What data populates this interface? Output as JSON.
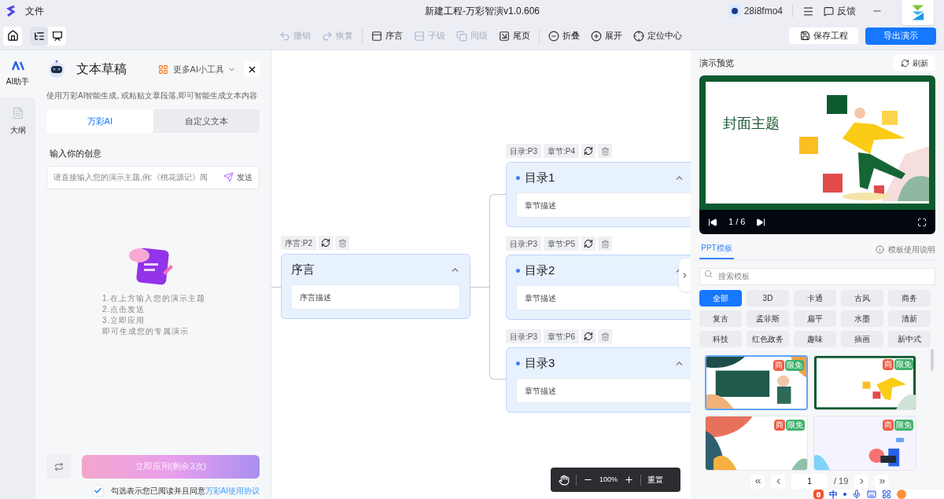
{
  "title_bar": {
    "menu": "文件",
    "title": "新建工程-万彩智演v1.0.606",
    "user": "28i8fmo4",
    "feedback": "反馈"
  },
  "toolbar": {
    "items": [
      {
        "kind": "undo",
        "label": "撤销",
        "disabled": true
      },
      {
        "kind": "redo",
        "label": "恢复",
        "disabled": true
      },
      {
        "kind": "preface",
        "label": "序言",
        "disabled": false
      },
      {
        "kind": "child",
        "label": "子级",
        "disabled": true
      },
      {
        "kind": "sibling",
        "label": "同级",
        "disabled": true
      },
      {
        "kind": "end",
        "label": "尾页",
        "disabled": false
      },
      {
        "kind": "collapse",
        "label": "折叠",
        "disabled": false
      },
      {
        "kind": "expand",
        "label": "展开",
        "disabled": false
      },
      {
        "kind": "locate",
        "label": "定位中心",
        "disabled": false
      }
    ],
    "save": "保存工程",
    "export": "导出演示"
  },
  "side_rail": [
    {
      "kind": "ai",
      "label": "AI助手",
      "selected": true
    },
    {
      "kind": "outline",
      "label": "大纲",
      "selected": false
    }
  ],
  "ai_panel": {
    "title": "文本草稿",
    "tools": "更多AI小工具",
    "description": "使用万彩AI智能生成, 或粘贴文章段落,即可智能生成文本内容",
    "tabs": [
      {
        "label": "万彩AI",
        "selected": true
      },
      {
        "label": "自定义文本",
        "selected": false
      }
    ],
    "input_label": "输入你的创意",
    "placeholder": "请直接输入您的演示主题,例:《桃花源记》阅",
    "send": "发送",
    "steps": [
      "1.在上方输入您的演示主题",
      "2.点击发送",
      "3.立即应用",
      "即可生成您的专属演示"
    ],
    "apply": "立即应用(剩余3次)",
    "agree": {
      "checked": true,
      "text": "勾选表示您已阅读并且同意",
      "link": "万彩AI使用协议"
    }
  },
  "canvas": {
    "root": {
      "tags": [
        "序言:P2"
      ],
      "title": "序言",
      "description": "序言描述",
      "expanded": true,
      "children": [
        {
          "tags": [
            "目录:P3",
            "章节:P4"
          ],
          "title": "目录1",
          "description": "章节描述",
          "expanded": true
        },
        {
          "tags": [
            "目录:P3",
            "章节:P5"
          ],
          "title": "目录2",
          "description": "章节描述",
          "expanded": true
        },
        {
          "tags": [
            "目录:P3",
            "章节:P6"
          ],
          "title": "目录3",
          "description": "章节描述",
          "expanded": true
        }
      ]
    },
    "zoom": "100%",
    "reset": "重置"
  },
  "preview": {
    "title": "演示预览",
    "refresh": "刷新",
    "slide_title": "封面主题",
    "page": "1 / 6"
  },
  "templates": {
    "tabs": [
      {
        "label": "PPT模板",
        "selected": true
      }
    ],
    "help": "模板使用说明",
    "search_placeholder": "搜索模板",
    "categories": [
      {
        "label": "全部",
        "selected": true
      },
      {
        "label": "3D",
        "selected": false
      },
      {
        "label": "卡通",
        "selected": false
      },
      {
        "label": "古风",
        "selected": false
      },
      {
        "label": "商务",
        "selected": false
      },
      {
        "label": "复古",
        "selected": false
      },
      {
        "label": "孟菲斯",
        "selected": false
      },
      {
        "label": "扁平",
        "selected": false
      },
      {
        "label": "水墨",
        "selected": false
      },
      {
        "label": "清新",
        "selected": false
      },
      {
        "label": "科技",
        "selected": false
      },
      {
        "label": "红色政务",
        "selected": false
      },
      {
        "label": "趣味",
        "selected": false
      },
      {
        "label": "插画",
        "selected": false
      },
      {
        "label": "新中式",
        "selected": false
      }
    ],
    "items": [
      {
        "selected": true,
        "badges": [
          "商",
          "限免"
        ]
      },
      {
        "selected": false,
        "badges": [
          "商",
          "限免"
        ]
      },
      {
        "selected": false,
        "badges": [
          "商",
          "限免"
        ]
      },
      {
        "selected": false,
        "badges": [
          "商",
          "限免"
        ]
      }
    ],
    "page": "1",
    "total": "/ 19"
  },
  "ime_bar": {
    "label": "中"
  }
}
